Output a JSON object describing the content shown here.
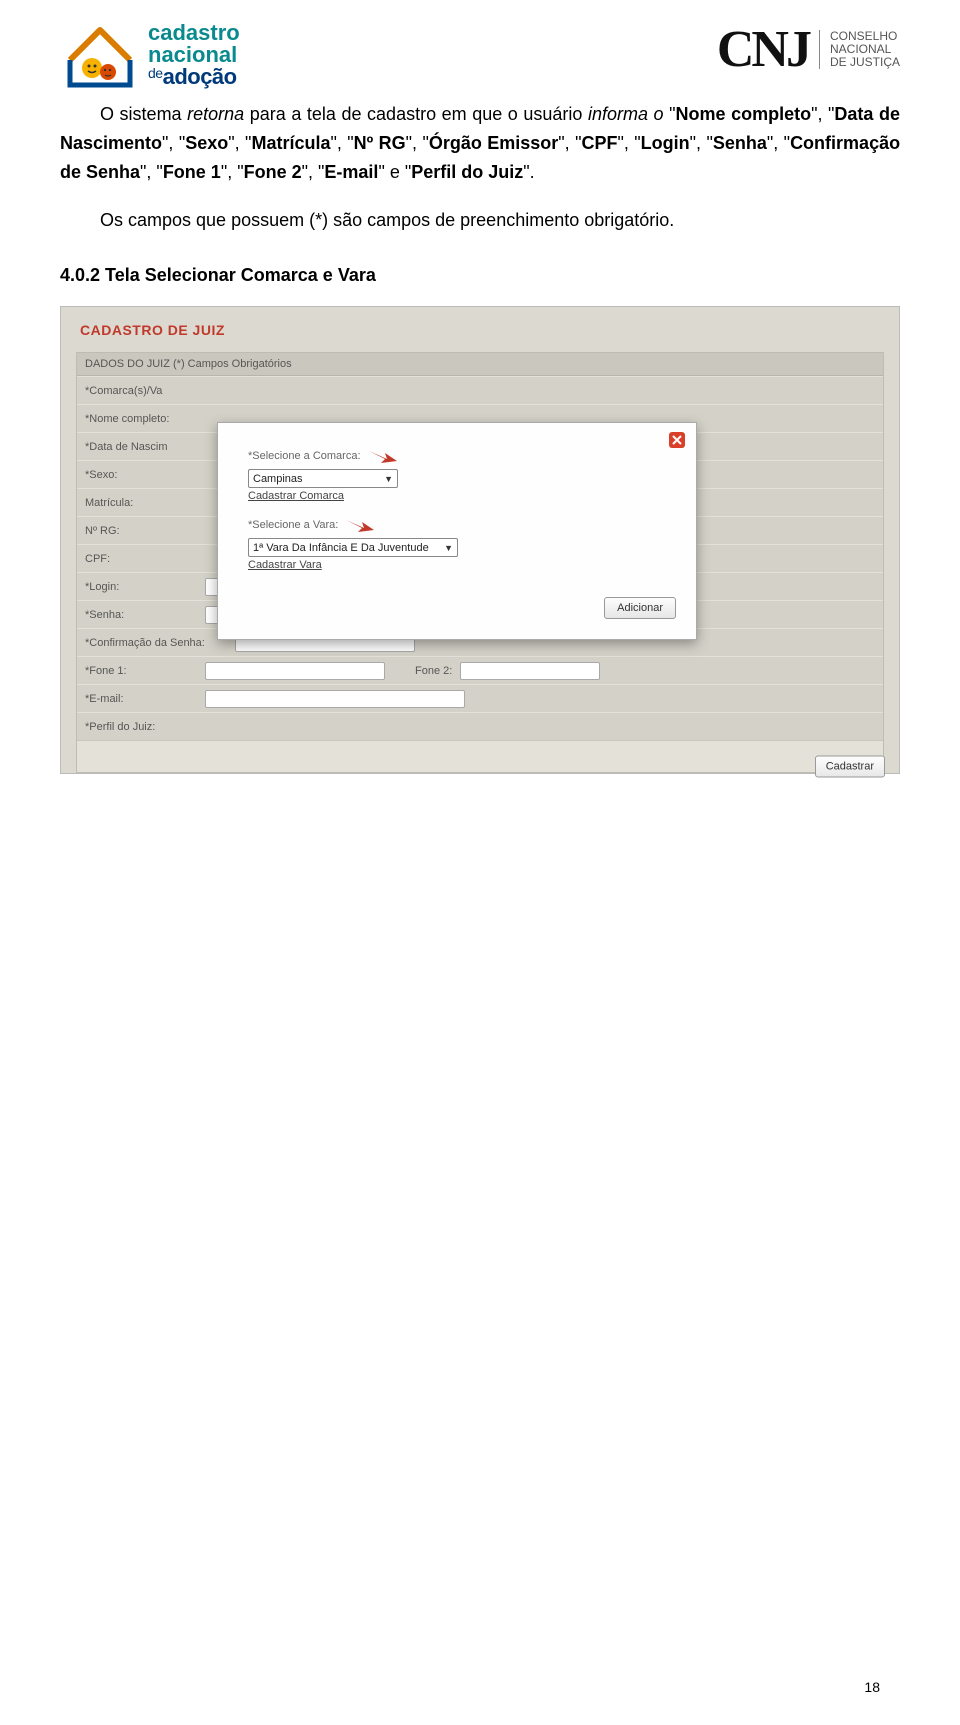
{
  "header": {
    "logo_left": {
      "line1": "cadastro",
      "line2": "nacional",
      "line3_de": "de",
      "line3": "adoção"
    },
    "logo_right": {
      "cnj": "CNJ",
      "line1": "CONSELHO",
      "line2": "NACIONAL",
      "line3": "DE JUSTIÇA"
    }
  },
  "para1": {
    "t1": "O sistema ",
    "t2_ital": "retorna",
    "t3": " para a tela de cadastro em que o usuário ",
    "t4_ital": "informa o ",
    "t5": "\"",
    "f1": "Nome completo",
    "s": "\", \"",
    "f2": "Data de Nascimento",
    "f3": "Sexo",
    "f4": "Matrícula",
    "f5": "Nº RG",
    "f6": "Órgão Emissor",
    "f7": "CPF",
    "f8": "Login",
    "f9": "Senha",
    "f10": "Confirmação de Senha",
    "f11": "Fone 1",
    "f12": "Fone 2",
    "f13": "E-mail",
    "t_e": "\" e \"",
    "f14": "Perfil do Juiz",
    "end": "\"."
  },
  "para2": "Os campos que possuem (*) são campos de preenchimento obrigatório.",
  "heading": "4.0.2  Tela Selecionar Comarca e Vara",
  "form": {
    "title": "CADASTRO DE JUIZ",
    "panel_head": "DADOS DO JUIZ  (*) Campos Obrigatórios",
    "labels": {
      "comarca": "*Comarca(s)/Va",
      "nome": "*Nome completo:",
      "data": "*Data de Nascim",
      "sexo": "*Sexo:",
      "matricula": "Matrícula:",
      "rg": "Nº RG:",
      "cpf": "CPF:",
      "login": "*Login:",
      "senha": "*Senha:",
      "confsenha": "*Confirmação da Senha:",
      "fone1": "*Fone 1:",
      "fone2": "Fone 2:",
      "email": "*E-mail:",
      "perfil": "*Perfil do Juiz:"
    },
    "btn_cadastrar": "Cadastrar"
  },
  "modal": {
    "label_comarca": "*Selecione a Comarca:",
    "select_comarca": "Campinas",
    "link_comarca": "Cadastrar Comarca",
    "label_vara": "*Selecione a Vara:",
    "select_vara": "1ª Vara Da Infância E Da Juventude",
    "link_vara": "Cadastrar Vara",
    "btn_add": "Adicionar"
  },
  "page_number": "18"
}
